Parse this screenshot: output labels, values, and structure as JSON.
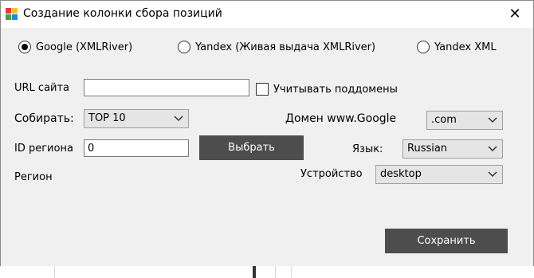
{
  "window": {
    "title": "Создание колонки сбора позиций",
    "close": "✕"
  },
  "engine_options": [
    {
      "label": "Google (XMLRiver)",
      "checked": true
    },
    {
      "label": "Yandex (Живая выдача XMLRiver)",
      "checked": false
    },
    {
      "label": "Yandex XML",
      "checked": false
    }
  ],
  "form": {
    "url_label": "URL сайта",
    "url_value": "",
    "subdomains_label": "Учитывать поддомены",
    "collect_label": "Собирать:",
    "collect_value": "TOP 10",
    "region_id_label": "ID региона",
    "region_id_value": "0",
    "choose_button": "Выбрать",
    "region_label": "Регион",
    "domain_label": "Домен www.Google",
    "domain_value": ".com",
    "language_label": "Язык:",
    "language_value": "Russian",
    "device_label": "Устройство",
    "device_value": "desktop",
    "save_button": "Сохранить"
  },
  "colors": {
    "window_bg": "#f0f0f0",
    "button_dark": "#4d4d4d",
    "select_bg": "#e5e5e5"
  }
}
